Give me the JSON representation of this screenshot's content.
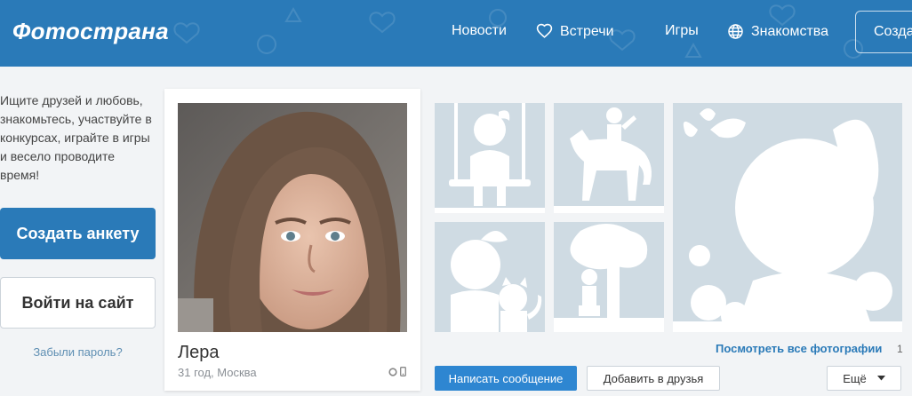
{
  "header": {
    "logo": "Фотострана",
    "nav": {
      "news": "Новости",
      "meetings": "Встречи",
      "games": "Игры",
      "dating": "Знакомства"
    },
    "create_button": "Созда"
  },
  "sidebar": {
    "intro": "Ищите друзей и любовь, знакомьтесь, участвуйте в конкурсах, играйте в игры и весело проводите время!",
    "create_profile": "Создать анкету",
    "login": "Войти на сайт",
    "forgot_password": "Забыли пароль?"
  },
  "profile": {
    "name": "Лера",
    "meta": "31 год, Москва"
  },
  "gallery": {
    "see_all": "Посмотреть все фотографии",
    "count": "1"
  },
  "actions": {
    "message": "Написать сообщение",
    "add_friend": "Добавить в друзья",
    "more": "Ещё"
  },
  "colors": {
    "brand": "#2a7ab8",
    "button_primary": "#2e86d1",
    "placeholder": "#cfdbe3"
  }
}
